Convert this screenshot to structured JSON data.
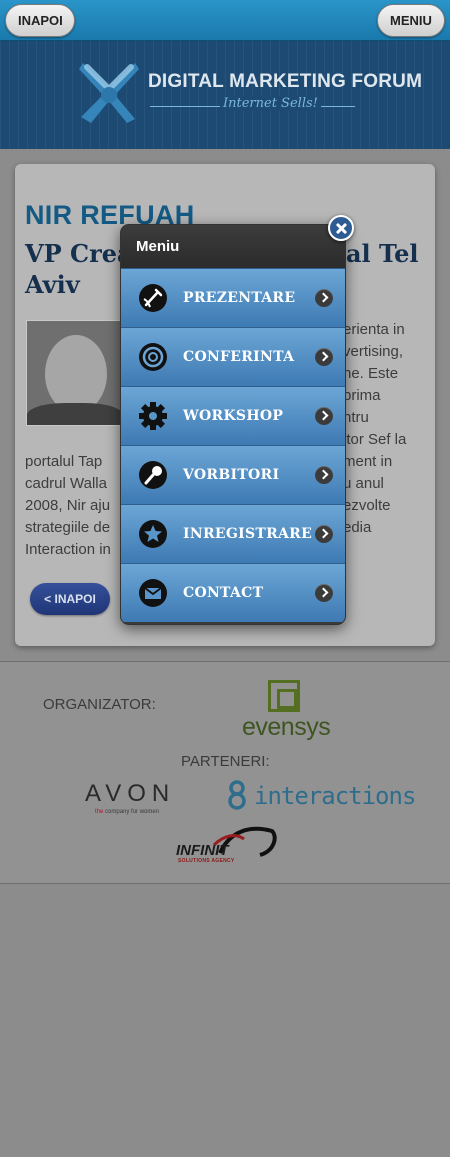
{
  "topbar": {
    "back_label": "INAPOI",
    "menu_label": "MENIU"
  },
  "header": {
    "logo_title": "DIGITAL MARKETING FORUM",
    "logo_subtitle": "Internet Sells!"
  },
  "speaker": {
    "name": "NIR REFUAH",
    "role": "VP Crea",
    "role_right": "al Tel",
    "role_line2": "Aviv",
    "bio_right": [
      "erienta in",
      "vertising,",
      "ne. Este",
      "prima",
      "ntru",
      "itor Sef la",
      "ment in",
      "u anul",
      "ezvolte",
      "edia"
    ],
    "bio_left": [
      "portalul Tap",
      "cadrul Walla",
      "2008, Nir aju",
      "strategiile de",
      "Interaction in"
    ],
    "back_button": "< INAPOI"
  },
  "footer": {
    "organizer_label": "ORGANIZATOR:",
    "partners_label": "PARTENERI:",
    "evensys": "evensys",
    "avon": "AVON",
    "avon_sub_highlight": "the",
    "avon_sub": "company for women",
    "interactions": "interactions",
    "infinit": "INFINIT",
    "infinit_sub": "SOLUTIONS AGENCY"
  },
  "menu": {
    "title": "Meniu",
    "items": [
      {
        "label": "PREZENTARE",
        "icon": "presentation-icon"
      },
      {
        "label": "CONFERINTA",
        "icon": "target-icon"
      },
      {
        "label": "WORKSHOP",
        "icon": "gear-icon"
      },
      {
        "label": "VORBITORI",
        "icon": "microphone-icon"
      },
      {
        "label": "INREGISTRARE",
        "icon": "star-icon"
      },
      {
        "label": "CONTACT",
        "icon": "envelope-icon"
      }
    ]
  },
  "colors": {
    "topbar": "#1f88bd",
    "header": "#1d4a73",
    "speaker_name": "#135a85",
    "menu_item": "#4f8cc4",
    "back_button": "#2a4488"
  }
}
